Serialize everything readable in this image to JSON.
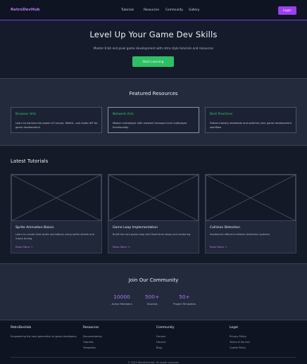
{
  "nav": {
    "logo": "RetroDevHub",
    "links": [
      "Tutorials",
      "Resources",
      "Community",
      "Gallery"
    ],
    "login_label": "Login"
  },
  "hero": {
    "title": "Level Up Your Game Dev Skills",
    "subtitle": "Master 8 bit and pixel game development with retro style tutorials and resources",
    "cta_label": "Start Learning"
  },
  "featured": {
    "title": "Featured Resources",
    "cards": [
      {
        "title": "Browser Arts",
        "desc": "Learn to harness the power of Canvas, WebGL, and Audio API for game development"
      },
      {
        "title": "Network Arts",
        "desc": "Master multiplayer with network transport and multiplayer functionality"
      },
      {
        "title": "Best Practices",
        "desc": "Follow industry standards and optimize your game development workflow"
      }
    ]
  },
  "latest": {
    "title": "Latest Tutorials",
    "cards": [
      {
        "title": "Sprite Animation Basics",
        "desc": "Learn to create fluid sprite animations using sprite sheets and frame timing",
        "link": "Read More →"
      },
      {
        "title": "Game Loop Implementation",
        "desc": "Build the core game loop with fixed time steps and rendering",
        "link": "Read More →"
      },
      {
        "title": "Collision Detection",
        "desc": "Implement efficient collision detection systems",
        "link": "Read More →"
      }
    ]
  },
  "community": {
    "title": "Join Our Community",
    "stats": [
      {
        "value": "10000",
        "label": "Active Members"
      },
      {
        "value": "500+",
        "label": "Tutorials"
      },
      {
        "value": "50+",
        "label": "Project Templates"
      }
    ]
  },
  "footer": {
    "brand": "RetroDevHub",
    "tagline": "Empowering the next generation of game developers",
    "columns": [
      {
        "heading": "Resources",
        "links": [
          "Documentation",
          "Tutorials",
          "Templates"
        ]
      },
      {
        "heading": "Community",
        "links": [
          "Forums",
          "Discord",
          "Blog"
        ]
      },
      {
        "heading": "Legal",
        "links": [
          "Privacy Policy",
          "Terms of Service",
          "Cookie Policy"
        ]
      }
    ],
    "copyright": "© 2024 RetroDevHub. All rights reserved."
  },
  "colors": {
    "accent": "#9b3ff0",
    "cta": "#2fbf64",
    "card_title": "#35c46c",
    "stat": "#a877f2"
  }
}
